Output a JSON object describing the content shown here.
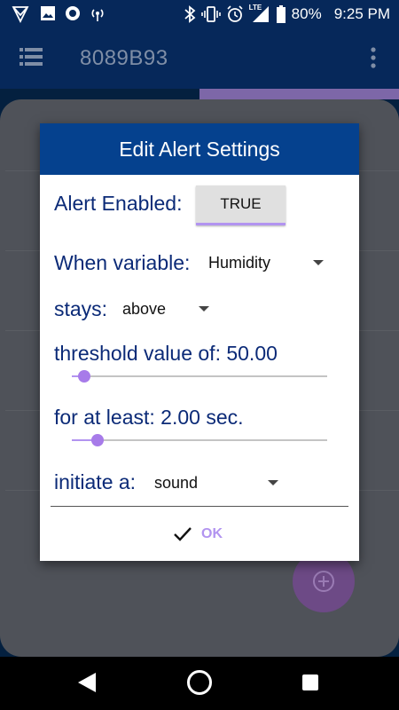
{
  "status_bar": {
    "battery_percent": "80%",
    "time": "9:25 PM",
    "network_label": "LTE",
    "left_icons": [
      "app-logo-icon",
      "image-icon",
      "record-icon",
      "wireless-icon"
    ],
    "right_icons": [
      "bluetooth-icon",
      "vibrate-icon",
      "alarm-icon",
      "signal-icon",
      "battery-icon"
    ]
  },
  "app_bar": {
    "title": "8089B93",
    "menu_icon": "list-menu-icon",
    "overflow_icon": "more-vert-icon"
  },
  "dialog": {
    "title": "Edit Alert Settings",
    "alert_enabled_label": "Alert Enabled:",
    "alert_enabled_value": "TRUE",
    "variable_label": "When variable:",
    "variable_value": "Humidity",
    "condition_label": "stays:",
    "condition_value": "above",
    "threshold_label": "threshold value of:",
    "threshold_value": "50.00",
    "threshold_slider_fraction": 0.05,
    "duration_label": "for at least:",
    "duration_value": "2.00 sec.",
    "duration_slider_fraction": 0.1,
    "action_label": "initiate a:",
    "action_value": "sound",
    "ok_label": "OK",
    "ok_icon": "check-icon"
  },
  "fab": {
    "icon": "add-circle-icon"
  },
  "colors": {
    "dialog_header": "#05418E",
    "label_text": "#0B2A77",
    "accent": "#B294F0",
    "app_bar": "#06285A"
  }
}
